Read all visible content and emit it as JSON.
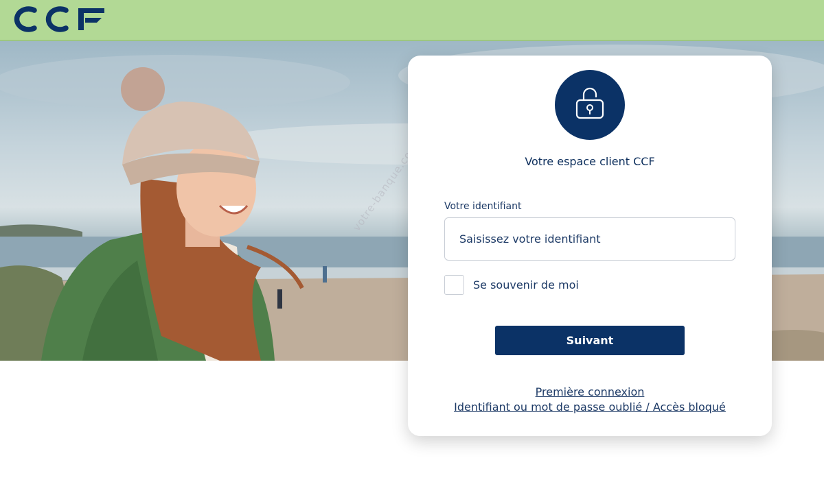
{
  "header": {
    "logo_text": "CCF",
    "brand_color": "#0b3266",
    "bar_color": "#b2d995"
  },
  "hero": {
    "image": "woman-in-knit-hat-on-beach"
  },
  "login_card": {
    "icon": "unlock-icon",
    "title": "Votre espace client CCF",
    "identifier_label": "Votre identifiant",
    "identifier_value": "",
    "identifier_placeholder": "Saisissez votre identifiant",
    "remember_label": "Se souvenir de moi",
    "remember_checked": false,
    "submit_label": "Suivant",
    "link_first_login": "Première connexion",
    "link_forgot": "Identifiant ou mot de passe oublié / Accès bloqué"
  },
  "watermark": "votre-banque.com"
}
